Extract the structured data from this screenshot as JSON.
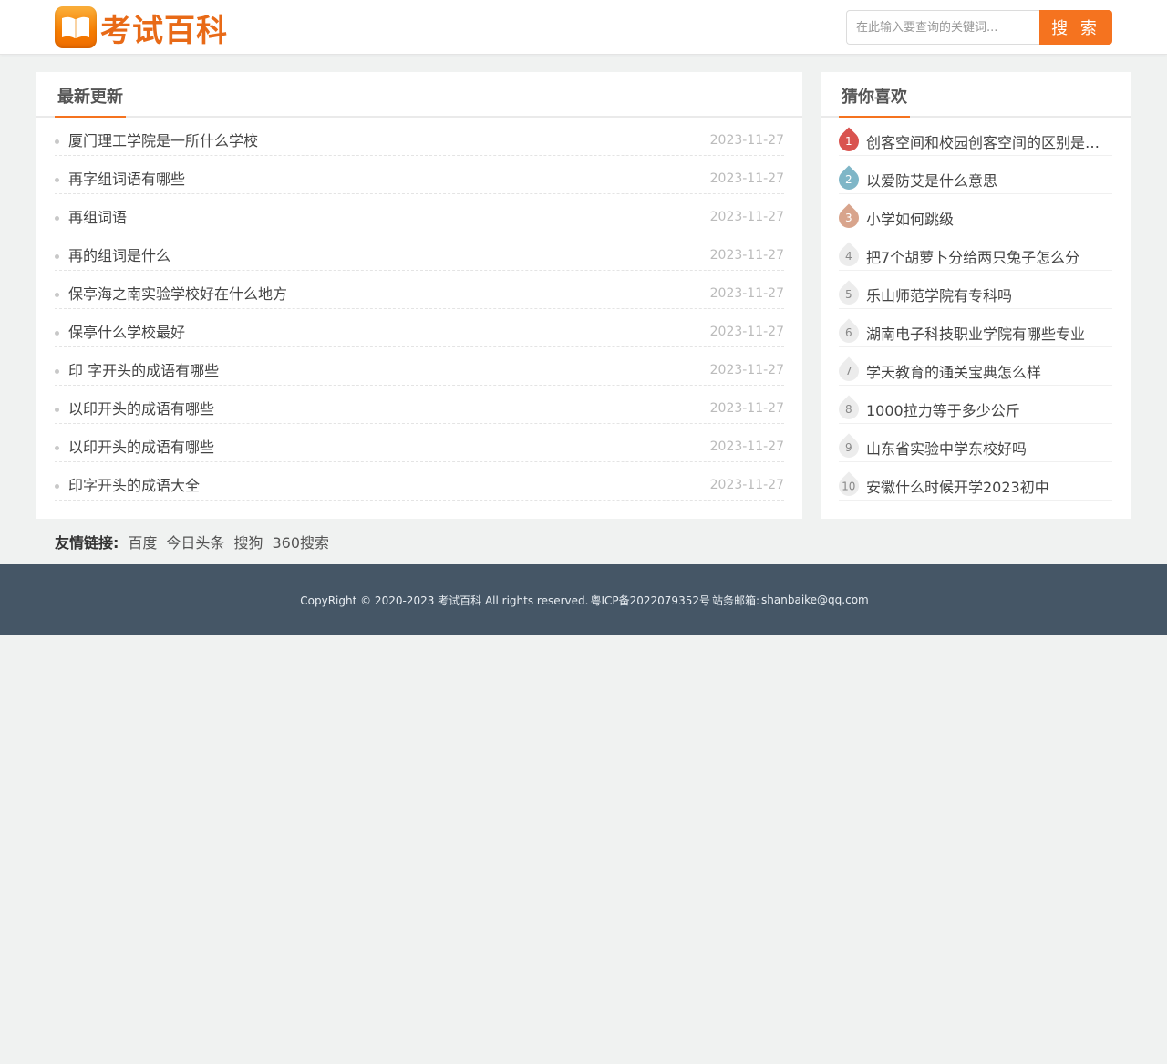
{
  "header": {
    "logo_text": "考试百科",
    "logo_icon": "open-book-icon",
    "search_placeholder": "在此输入要查询的关键词...",
    "search_button": "搜 索"
  },
  "latest": {
    "title": "最新更新",
    "items": [
      {
        "title": "厦门理工学院是一所什么学校",
        "date": "2023-11-27"
      },
      {
        "title": "再字组词语有哪些",
        "date": "2023-11-27"
      },
      {
        "title": "再组词语",
        "date": "2023-11-27"
      },
      {
        "title": "再的组词是什么",
        "date": "2023-11-27"
      },
      {
        "title": "保亭海之南实验学校好在什么地方",
        "date": "2023-11-27"
      },
      {
        "title": "保亭什么学校最好",
        "date": "2023-11-27"
      },
      {
        "title": "印 字开头的成语有哪些",
        "date": "2023-11-27"
      },
      {
        "title": "以印开头的成语有哪些",
        "date": "2023-11-27"
      },
      {
        "title": "以印开头的成语有哪些",
        "date": "2023-11-27"
      },
      {
        "title": "印字开头的成语大全",
        "date": "2023-11-27"
      }
    ]
  },
  "guess": {
    "title": "猜你喜欢",
    "items": [
      {
        "rank": "1",
        "title": "创客空间和校园创客空间的区别是什么"
      },
      {
        "rank": "2",
        "title": "以爱防艾是什么意思"
      },
      {
        "rank": "3",
        "title": "小学如何跳级"
      },
      {
        "rank": "4",
        "title": "把7个胡萝卜分给两只兔子怎么分"
      },
      {
        "rank": "5",
        "title": "乐山师范学院有专科吗"
      },
      {
        "rank": "6",
        "title": "湖南电子科技职业学院有哪些专业"
      },
      {
        "rank": "7",
        "title": "学天教育的通关宝典怎么样"
      },
      {
        "rank": "8",
        "title": "1000拉力等于多少公斤"
      },
      {
        "rank": "9",
        "title": "山东省实验中学东校好吗"
      },
      {
        "rank": "10",
        "title": "安徽什么时候开学2023初中"
      }
    ],
    "rank_colors": [
      "#d9534f",
      "#7fb6c7",
      "#d8a48c"
    ]
  },
  "links": {
    "label": "友情链接:",
    "items": [
      "百度",
      "今日头条",
      "搜狗",
      "360搜索"
    ]
  },
  "footer": {
    "copyright": "CopyRight © 2020-2023 考试百科 All rights reserved.",
    "icp": "粤ICP备2022079352号",
    "email_label": "站务邮箱:",
    "email": "shanbaike@qq.com"
  },
  "colors": {
    "accent": "#f5731f",
    "footer_bg": "#455666",
    "page_bg": "#f0f2f1"
  }
}
